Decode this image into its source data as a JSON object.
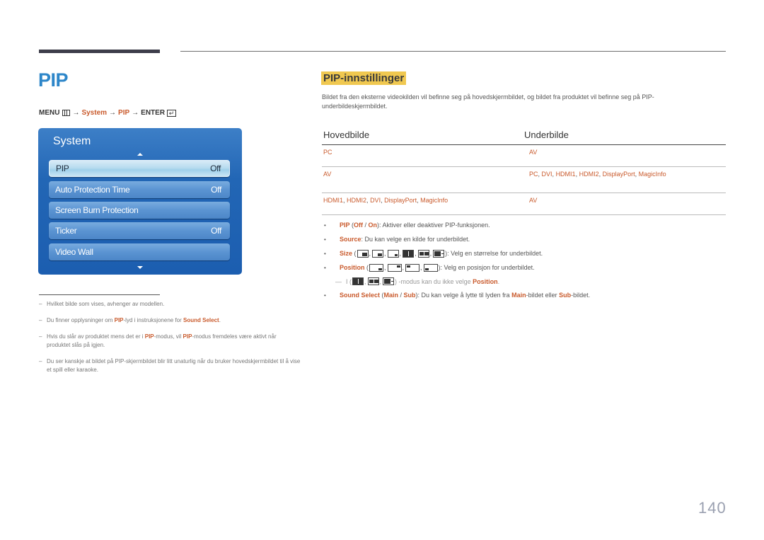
{
  "page": {
    "title": "PIP",
    "number": "140"
  },
  "menu_path": {
    "menu": "MENU",
    "arrow": "→",
    "system": "System",
    "pip": "PIP",
    "enter": "ENTER",
    "enter_glyph": "↵"
  },
  "osd": {
    "title": "System",
    "items": [
      {
        "label": "PIP",
        "value": "Off",
        "selected": true
      },
      {
        "label": "Auto Protection Time",
        "value": "Off",
        "selected": false
      },
      {
        "label": "Screen Burn Protection",
        "value": "",
        "selected": false
      },
      {
        "label": "Ticker",
        "value": "Off",
        "selected": false
      },
      {
        "label": "Video Wall",
        "value": "",
        "selected": false
      }
    ]
  },
  "notes": [
    {
      "parts": [
        {
          "t": "Hvilket bilde som vises, avhenger av modellen."
        }
      ]
    },
    {
      "parts": [
        {
          "t": "Du finner opplysninger om "
        },
        {
          "t": "PIP",
          "hl": true
        },
        {
          "t": "-lyd i instruksjonene for "
        },
        {
          "t": "Sound Select",
          "hl": true
        },
        {
          "t": "."
        }
      ]
    },
    {
      "parts": [
        {
          "t": "Hvis du slår av produktet mens det er i "
        },
        {
          "t": "PIP",
          "hl": true
        },
        {
          "t": "-modus, vil "
        },
        {
          "t": "PIP",
          "hl": true
        },
        {
          "t": "-modus fremdeles være aktivt når produktet slås på igjen."
        }
      ]
    },
    {
      "parts": [
        {
          "t": "Du ser kanskje at bildet på PIP-skjermbildet blir litt unaturlig når du bruker hovedskjermbildet til å vise et spill eller karaoke."
        }
      ]
    }
  ],
  "section": {
    "title": "PIP-innstillinger",
    "intro": "Bildet fra den eksterne videokilden vil befinne seg på hovedskjermbildet, og bildet fra produktet vil befinne seg på PIP-underbildeskjermbildet."
  },
  "table": {
    "headers": [
      "Hovedbilde",
      "Underbilde"
    ],
    "rows": [
      {
        "main": [
          "PC"
        ],
        "sub": [
          "AV"
        ]
      },
      {
        "main": [
          "AV"
        ],
        "sub": [
          "PC",
          "DVI",
          "HDMI1",
          "HDMI2",
          "DisplayPort",
          "MagicInfo"
        ]
      },
      {
        "main": [
          "HDMI1",
          "HDMI2",
          "DVI",
          "DisplayPort",
          "MagicInfo"
        ],
        "sub": [
          "AV"
        ]
      }
    ]
  },
  "bullets": {
    "pip": {
      "label": "PIP",
      "off": "Off",
      "slash": " / ",
      "on": "On",
      "text": ": Aktiver eller deaktiver PIP-funksjonen."
    },
    "source": {
      "label": "Source",
      "text": ": Du kan velge en kilde for underbildet."
    },
    "size": {
      "label": "Size",
      "text": ": Velg en størrelse for underbildet.",
      "icons": [
        "size-large-icon",
        "size-medium-icon",
        "size-small-icon",
        "size-split-equal-icon",
        "size-split-wide-icon",
        "size-split-narrow-icon"
      ]
    },
    "position": {
      "label": "Position",
      "text": ": Velg en posisjon for underbildet.",
      "icons": [
        "position-bottom-right-icon",
        "position-top-right-icon",
        "position-top-left-icon",
        "position-bottom-left-icon"
      ]
    },
    "position_note": {
      "prefix": "I (",
      "suffix": ") -modus kan du ikke velge ",
      "hl": "Position",
      "end": "."
    },
    "sound": {
      "label": "Sound Select",
      "main": "Main",
      "slash": " / ",
      "sub": "Sub",
      "text1": ": Du kan velge å lytte til lyden fra ",
      "main2": "Main",
      "text2": "-bildet eller ",
      "sub2": "Sub",
      "text3": "-bildet."
    }
  },
  "colors": {
    "accent_orange": "#c95a2c",
    "title_blue": "#2d86c9",
    "highlight_yellow": "#f0c850",
    "osd_blue": "#2266b5"
  }
}
